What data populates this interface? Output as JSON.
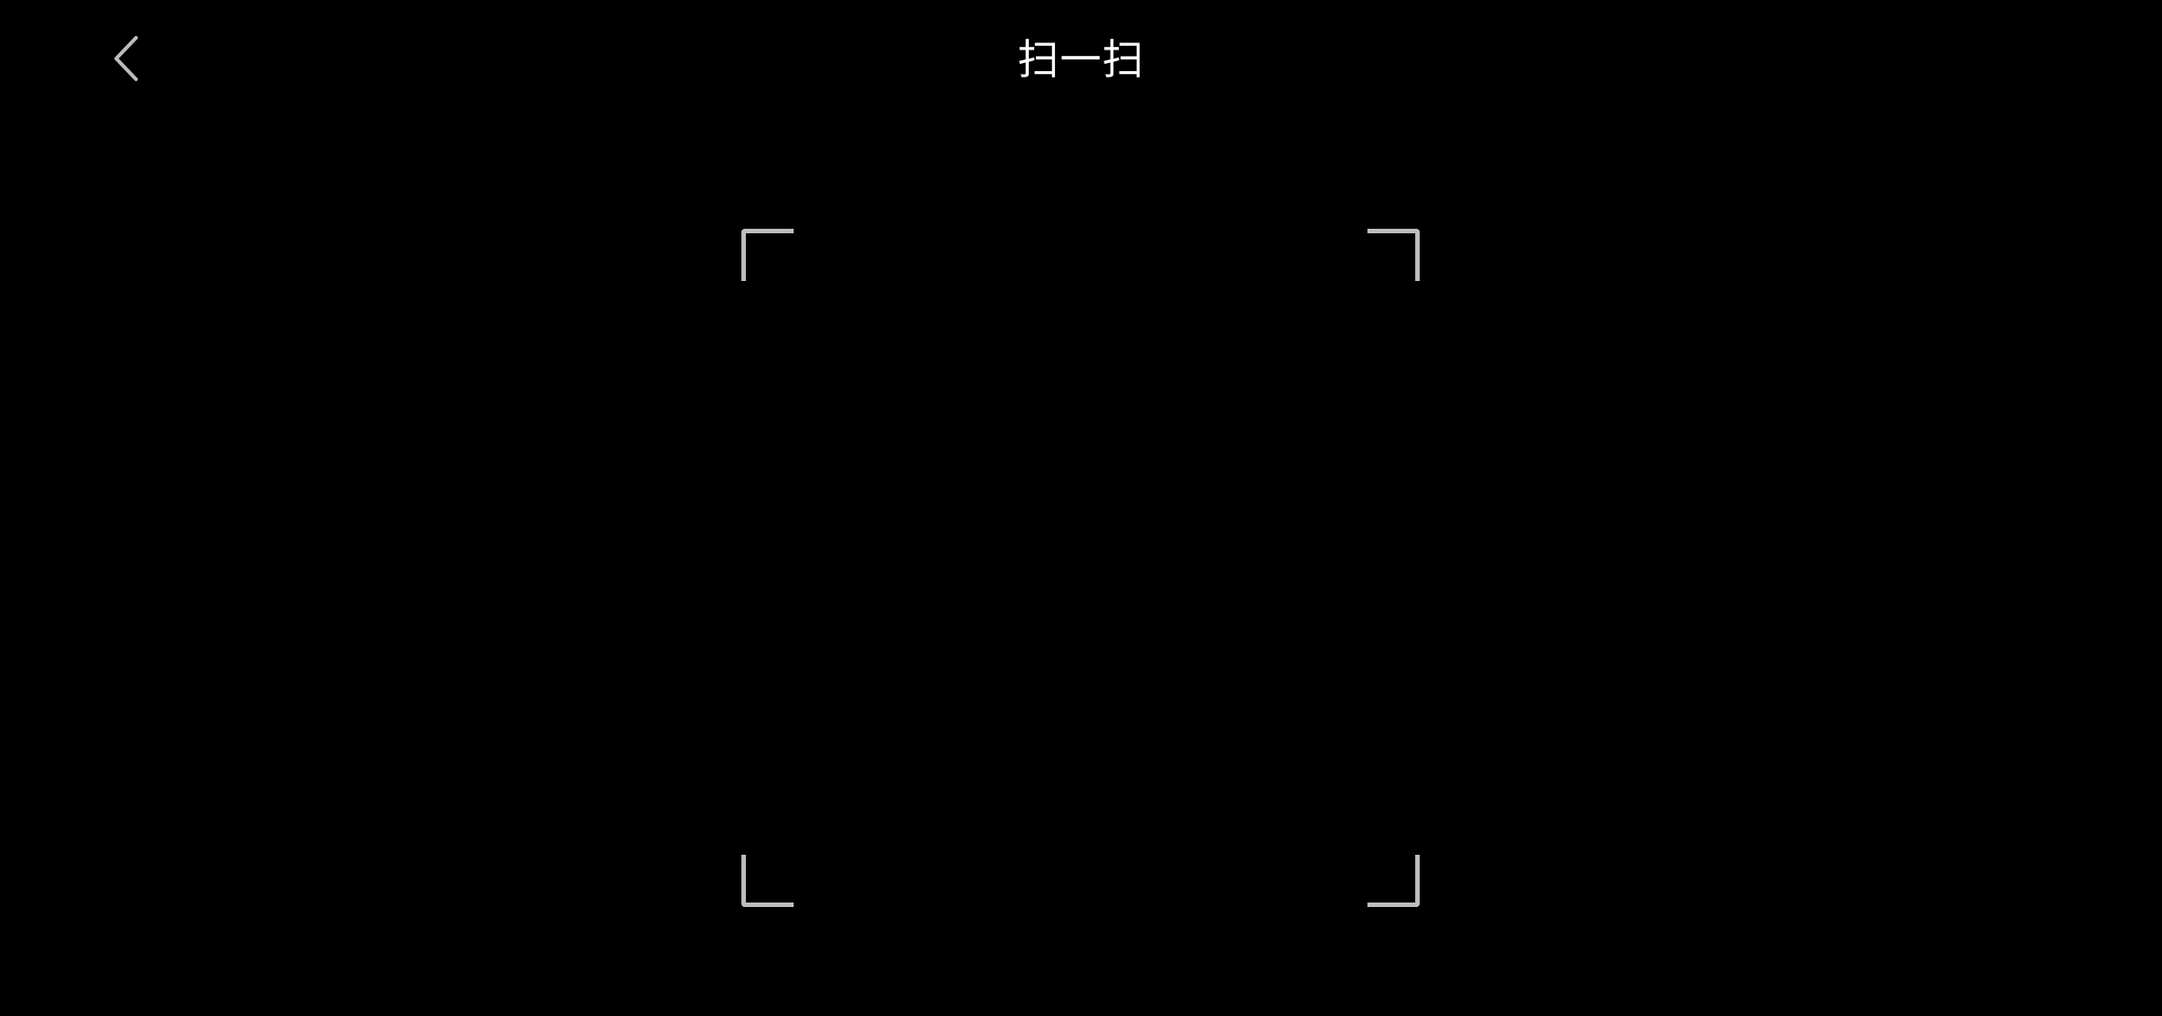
{
  "header": {
    "title": "扫一扫",
    "back_icon": "chevron-left-icon"
  },
  "colors": {
    "background": "#000000",
    "title_text": "#ffffff",
    "back_icon": "#bdbdbd",
    "frame_corners": "#bdbdbd"
  }
}
